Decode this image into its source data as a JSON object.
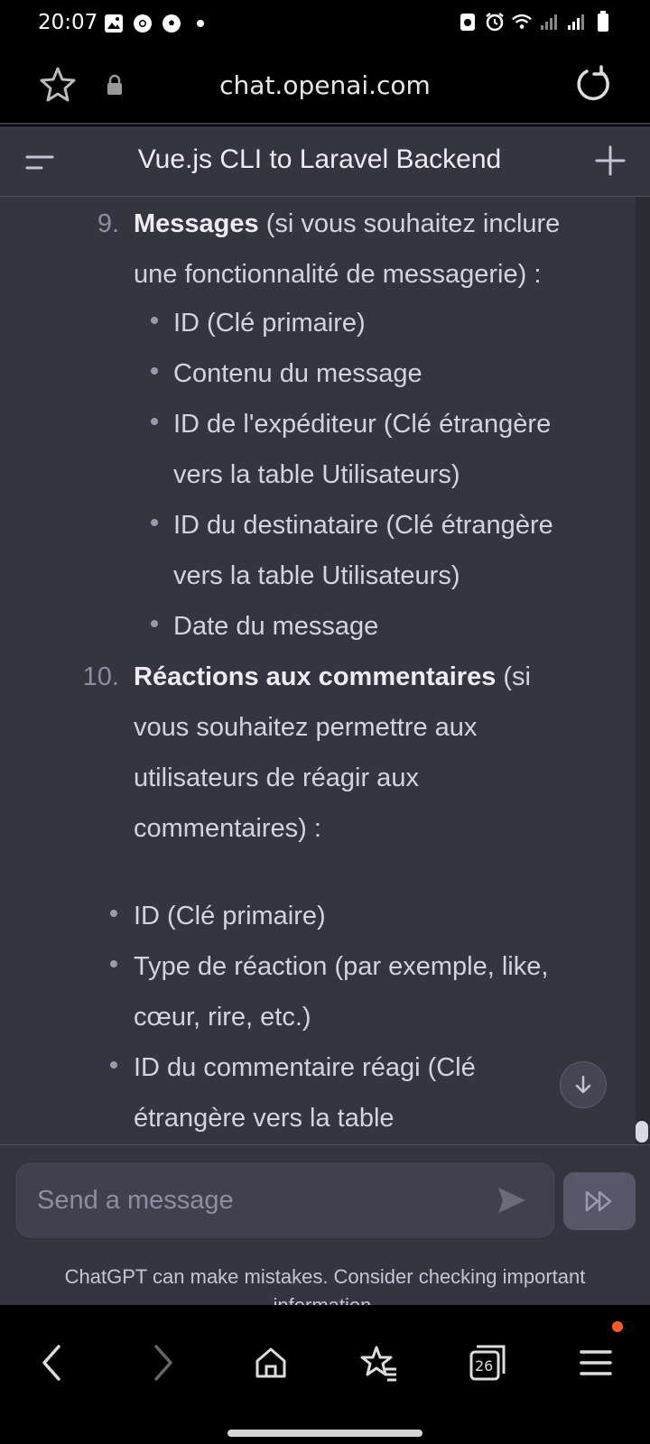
{
  "status_bar": {
    "time": "20:07"
  },
  "browser": {
    "url": "chat.openai.com"
  },
  "chat_header": {
    "title": "Vue.js CLI to Laravel Backend"
  },
  "content": {
    "item9": {
      "number": "9.",
      "title": "Messages",
      "desc_line1": " (si vous souhaitez inclure",
      "desc_line2": "une fonctionnalité de messagerie) :",
      "bullets": [
        {
          "line1": "ID (Clé primaire)"
        },
        {
          "line1": "Contenu du message"
        },
        {
          "line1": "ID de l'expéditeur (Clé étrangère",
          "line2": "vers la table Utilisateurs)"
        },
        {
          "line1": "ID du destinataire (Clé étrangère",
          "line2": "vers la table Utilisateurs)"
        },
        {
          "line1": "Date du message"
        }
      ]
    },
    "item10": {
      "number": "10.",
      "title": "Réactions aux commentaires",
      "desc_line1": " (si",
      "desc_line2": "vous souhaitez permettre aux",
      "desc_line3": "utilisateurs de réagir aux",
      "desc_line4": "commentaires) :"
    },
    "bullets_after": [
      {
        "line1": "ID (Clé primaire)"
      },
      {
        "line1": "Type de réaction (par exemple, like,",
        "line2": "cœur, rire, etc.)"
      },
      {
        "line1": "ID du commentaire réagi (Clé",
        "line2": "étrangère vers la table"
      }
    ]
  },
  "composer": {
    "placeholder": "Send a message",
    "disclaimer_line1": "ChatGPT can make mistakes. Consider checking important",
    "disclaimer_line2": "information."
  },
  "bottom_nav": {
    "tabs_count": "26"
  },
  "colors": {
    "chat_bg": "#343541",
    "composer_bg": "#40414f",
    "notif_dot": "#ff5a1f"
  }
}
